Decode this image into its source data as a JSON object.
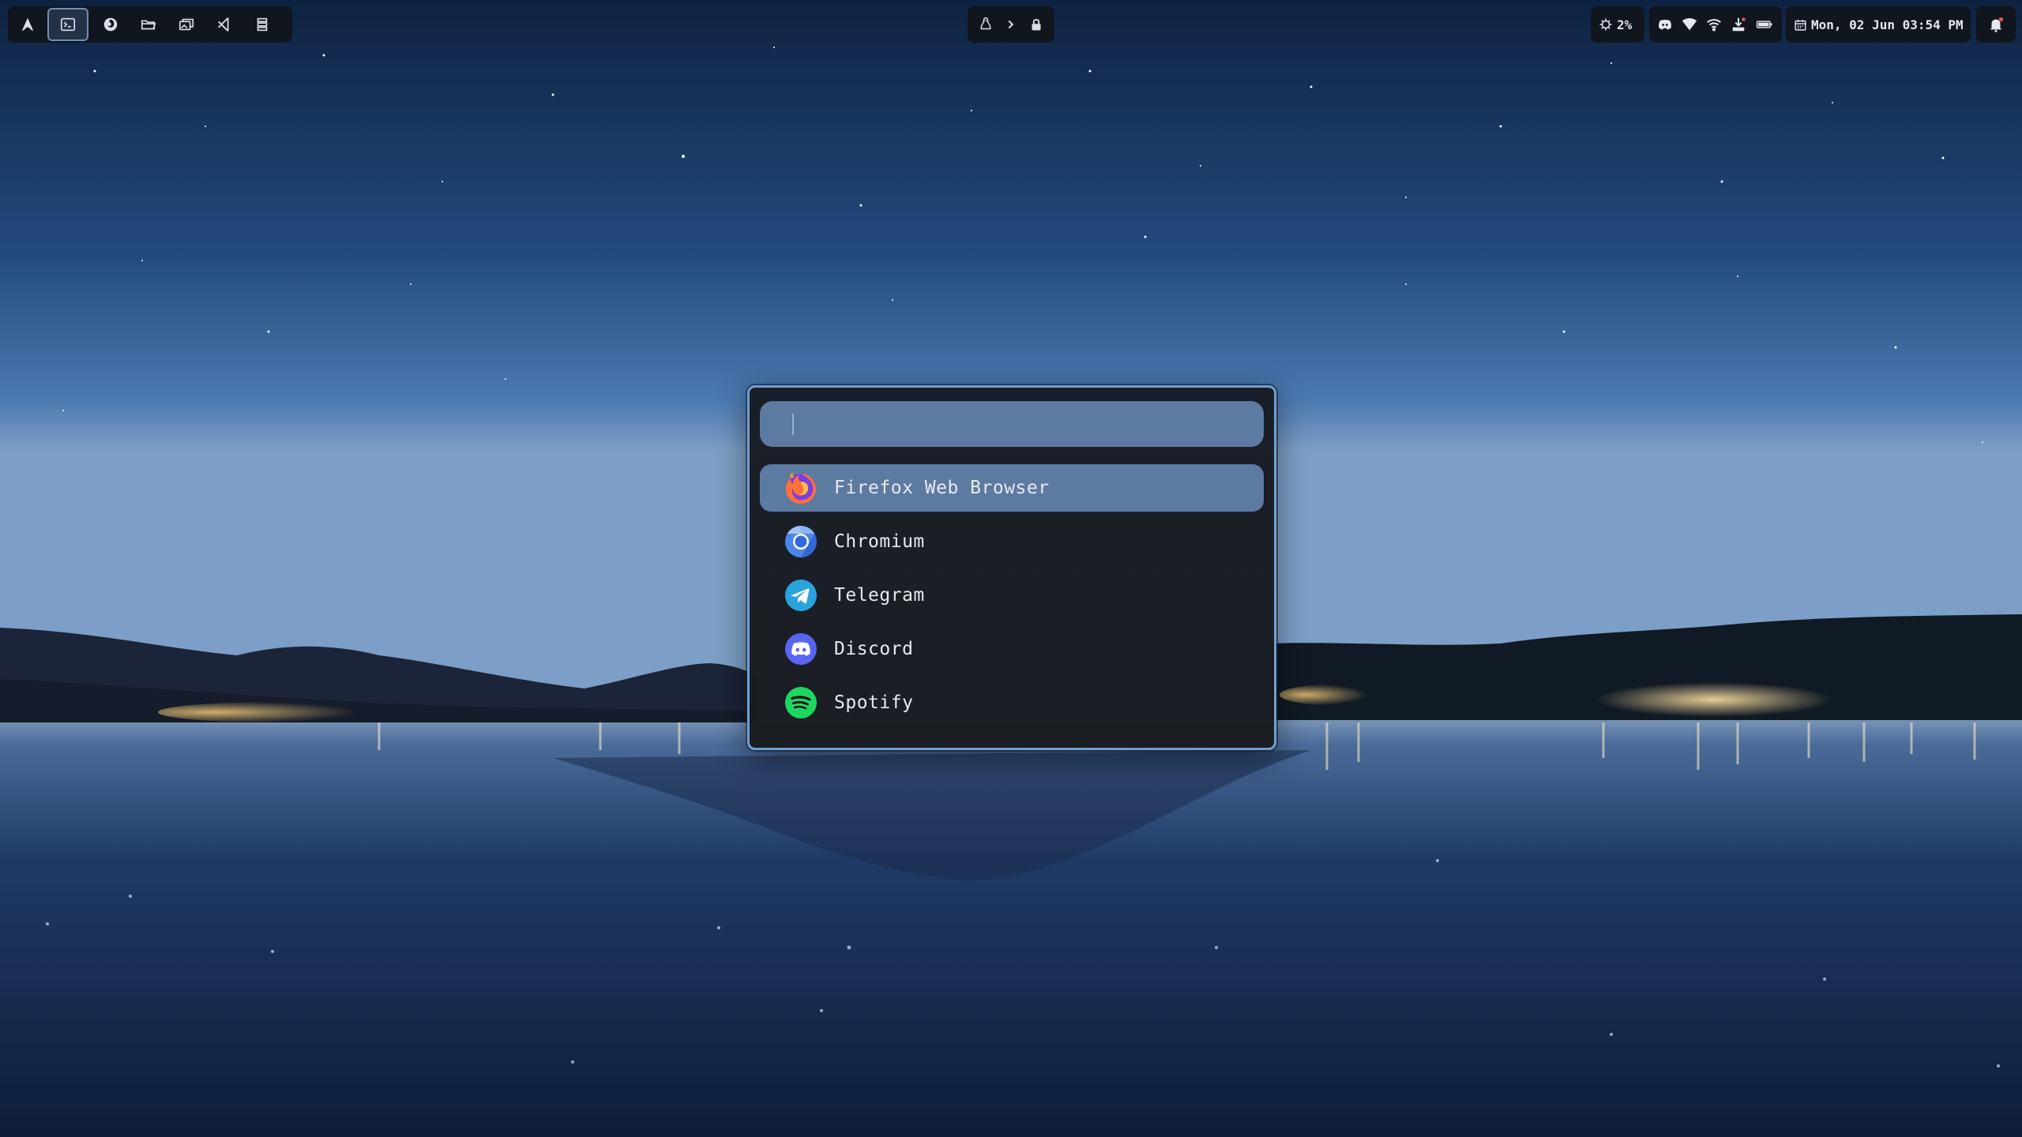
{
  "colors": {
    "bar_bg": "#10151e",
    "launcher_border": "#6f9fcf",
    "selection": "#5d7aa1",
    "text": "#e6eaf1"
  },
  "topbar": {
    "left_icons": [
      "arch-logo-icon",
      "terminal-icon",
      "firefox-icon",
      "folder-icon",
      "screenshot-gallery-icon",
      "vscode-icon",
      "list-icon"
    ],
    "center_icons": [
      "linux-penguin-icon",
      "chevron-right-icon",
      "lock-icon"
    ],
    "cpu": {
      "icon": "cpu-icon",
      "value": "2%"
    },
    "tray_icons": [
      "discord-icon",
      "wifi-signal-icon",
      "wifi-icon",
      "download-icon",
      "battery-icon"
    ],
    "clock": {
      "icon": "calendar-icon",
      "text": "Mon, 02 Jun 03:54 PM"
    },
    "notification_icon": "bell-icon"
  },
  "launcher": {
    "search": {
      "value": "",
      "placeholder": ""
    },
    "selected_index": 0,
    "apps": [
      {
        "label": "Firefox Web Browser",
        "icon": "firefox-icon"
      },
      {
        "label": "Chromium",
        "icon": "chromium-icon"
      },
      {
        "label": "Telegram",
        "icon": "telegram-icon"
      },
      {
        "label": "Discord",
        "icon": "discord-icon"
      },
      {
        "label": "Spotify",
        "icon": "spotify-icon"
      }
    ]
  }
}
